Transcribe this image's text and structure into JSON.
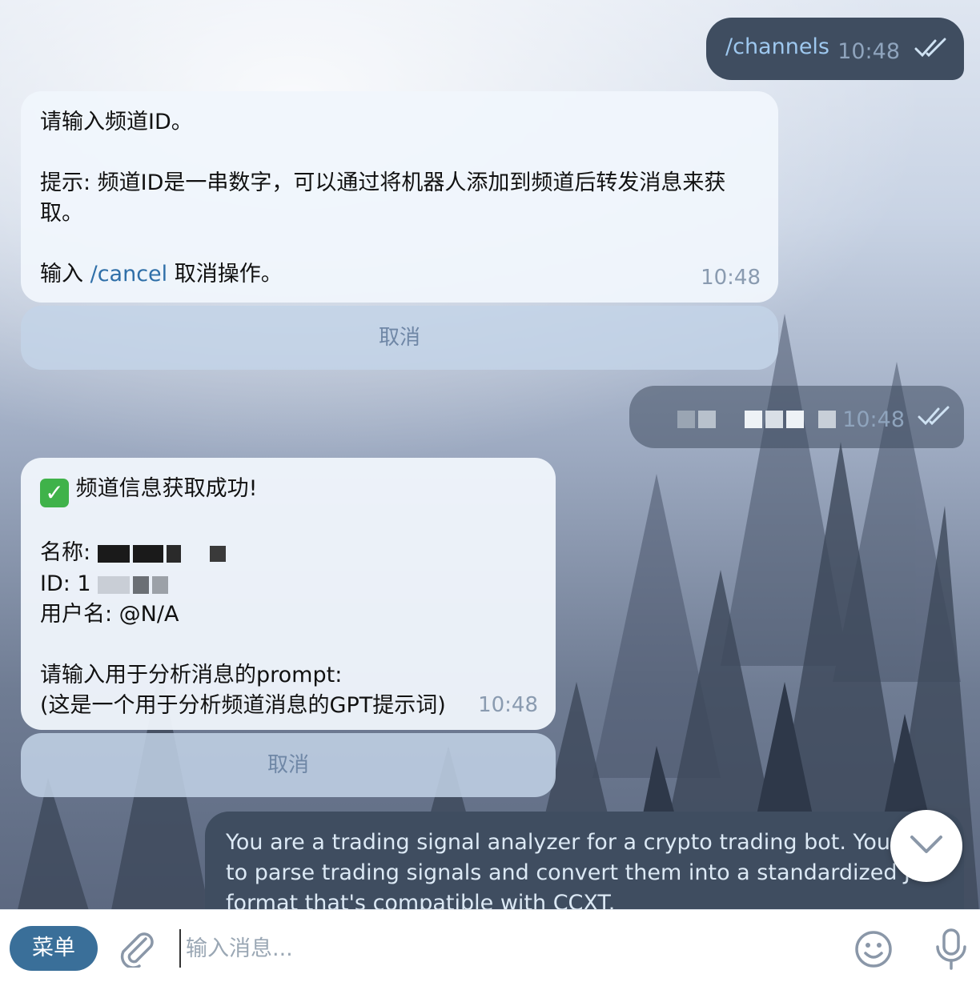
{
  "messages": [
    {
      "out_text": "/channels",
      "out_time": "10:48"
    },
    {
      "line1": "请输入频道ID。",
      "hint": "提示: 频道ID是一串数字，可以通过将机器人添加到频道后转发消息来获取。",
      "cancel_prefix": "输入 ",
      "cancel_cmd": "/cancel",
      "cancel_suffix": " 取消操作。",
      "time": "10:48",
      "button": "取消"
    },
    {
      "out_time": "10:48"
    },
    {
      "title": "频道信息获取成功!",
      "name_label": "名称:",
      "id_label": "ID: 1",
      "username": "用户名: @N/A",
      "prompt_line1": "请输入用于分析消息的prompt:",
      "prompt_line2": "(这是一个用于分析频道消息的GPT提示词)",
      "time": "10:48",
      "button": "取消"
    },
    {
      "out_text": "You are a trading signal analyzer for a crypto trading bot. Your ta to parse trading signals and convert them into a standardized JSO format that's compatible with CCXT."
    }
  ],
  "composer": {
    "menu_label": "菜单",
    "placeholder": "输入消息..."
  },
  "icons": {
    "check": "double-check-icon",
    "success": "check-mark-button-icon",
    "scroll": "chevron-down-icon",
    "attach": "paperclip-icon",
    "emoji": "smiley-icon",
    "mic": "microphone-icon"
  }
}
